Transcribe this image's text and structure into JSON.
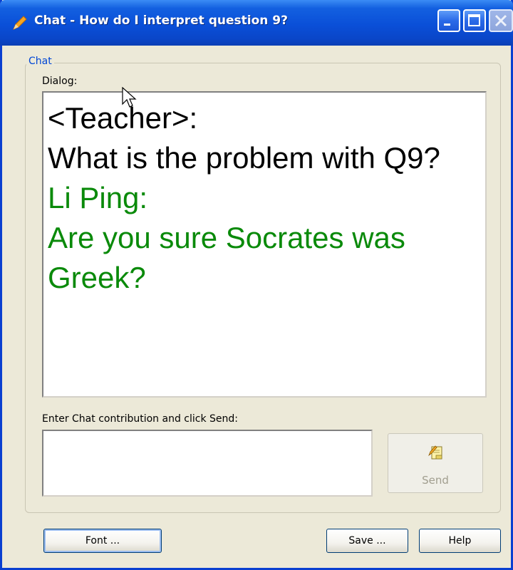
{
  "window": {
    "title": "Chat - How do I interpret question 9?"
  },
  "group": {
    "legend": "Chat"
  },
  "dialog": {
    "label": "Dialog:",
    "messages": [
      {
        "sender": "<Teacher>:",
        "text": "What is the problem with Q9?",
        "color": "#000000"
      },
      {
        "sender": "Li Ping:",
        "text": "Are you sure Socrates was Greek?",
        "color": "#0a8a0a"
      }
    ]
  },
  "compose": {
    "label": "Enter Chat contribution and click Send:",
    "value": "",
    "send_label": "Send",
    "send_icon": "note-pencil-icon"
  },
  "footer": {
    "font_label": "Font ...",
    "save_label": "Save ...",
    "help_label": "Help"
  },
  "colors": {
    "titlebar": "#0a4fd8",
    "accent": "#0046d5",
    "student_text": "#0a8a0a"
  }
}
